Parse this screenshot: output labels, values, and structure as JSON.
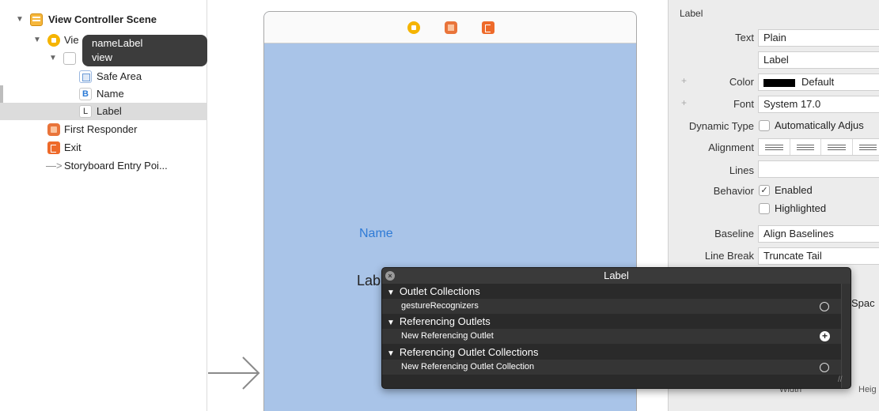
{
  "outline": {
    "scene": "View Controller Scene",
    "view_controller": "Vie",
    "safe_area": "Safe Area",
    "name": "Name",
    "label": "Label",
    "first_responder": "First Responder",
    "exit": "Exit",
    "entry_point": "Storyboard Entry Poi...",
    "safe_icon_letter": "",
    "name_icon_letter": "B",
    "label_icon_letter": "L"
  },
  "tooltip": {
    "line1": "nameLabel",
    "line2": "view"
  },
  "canvas": {
    "name_button": "Name",
    "label_text": "Lab"
  },
  "inspector": {
    "section_title": "Label",
    "text_label": "Text",
    "text_value": "Plain",
    "text_content": "Label",
    "color_label": "Color",
    "color_value": "Default",
    "font_label": "Font",
    "font_value": "System 17.0",
    "dynamic_type_label": "Dynamic Type",
    "dynamic_type_value": "Automatically Adjus",
    "alignment_label": "Alignment",
    "lines_label": "Lines",
    "lines_value": "",
    "behavior_label": "Behavior",
    "enabled_label": "Enabled",
    "highlighted_label": "Highlighted",
    "baseline_label": "Baseline",
    "baseline_value": "Align Baselines",
    "line_break_label": "Line Break",
    "line_break_value": "Truncate Tail",
    "spacing_partial": "Spac",
    "width_partial": "Width",
    "height_partial": "Heig",
    "plus_glyph": "+",
    "check_glyph": "✓"
  },
  "hud": {
    "title": "Label",
    "close_glyph": "×",
    "triangle_glyph": "▼",
    "plus_glyph": "+",
    "sections": [
      {
        "title": "Outlet Collections",
        "rows": [
          "gestureRecognizers"
        ]
      },
      {
        "title": "Referencing Outlets",
        "rows": [
          "New Referencing Outlet"
        ]
      },
      {
        "title": "Referencing Outlet Collections",
        "rows": [
          "New Referencing Outlet Collection"
        ]
      }
    ],
    "grip_glyph": "//"
  },
  "icons": {
    "disclosure_open": "▼",
    "entry_arrow": "—>"
  },
  "colors": {
    "canvas_view": "#a9c4e8",
    "hud_bg": "#2a2a2a",
    "link_blue": "#2f7bd6",
    "selection": "#dcdcdc"
  }
}
